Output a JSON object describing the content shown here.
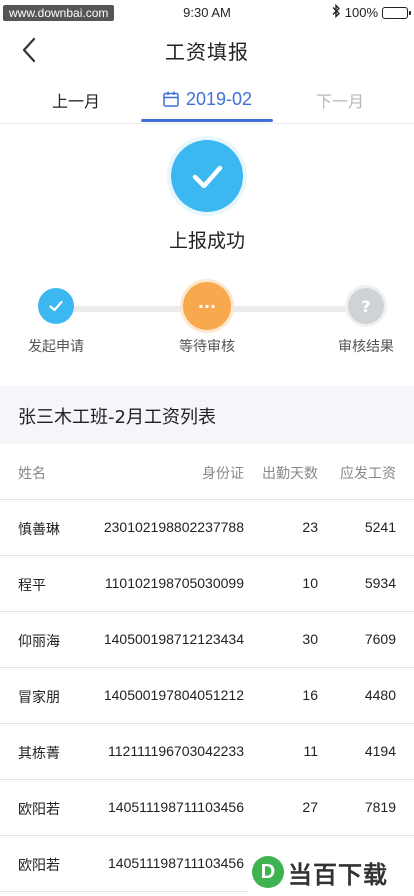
{
  "status_bar": {
    "watermark": "www.downbai.com",
    "time": "9:30 AM",
    "battery": "100%"
  },
  "header": {
    "title": "工资填报"
  },
  "month_tabs": {
    "prev": "上一月",
    "current": "2019-02",
    "next": "下一月"
  },
  "result": {
    "text": "上报成功"
  },
  "steps": [
    {
      "label": "发起申请",
      "state": "done"
    },
    {
      "label": "等待审核",
      "state": "current",
      "symbol": "···"
    },
    {
      "label": "审核结果",
      "state": "pending",
      "symbol": "?"
    }
  ],
  "list": {
    "title": "张三木工班-2月工资列表",
    "columns": [
      "姓名",
      "身份证",
      "出勤天数",
      "应发工资"
    ],
    "rows": [
      {
        "name": "慎善琳",
        "id": "230102198802237788",
        "days": "23",
        "pay": "5241"
      },
      {
        "name": "程平",
        "id": "110102198705030099",
        "days": "10",
        "pay": "5934"
      },
      {
        "name": "仰丽海",
        "id": "140500198712123434",
        "days": "30",
        "pay": "7609"
      },
      {
        "name": "冒家朋",
        "id": "140500197804051212",
        "days": "16",
        "pay": "4480"
      },
      {
        "name": "其栋菁",
        "id": "112111196703042233",
        "days": "11",
        "pay": "4194"
      },
      {
        "name": "欧阳若",
        "id": "140511198711103456",
        "days": "27",
        "pay": "7819"
      },
      {
        "name": "欧阳若",
        "id": "140511198711103456",
        "days": "",
        "pay": ""
      }
    ]
  },
  "corner_logo": {
    "mark": "D",
    "text": "当百下载"
  },
  "colors": {
    "accent": "#3f6fd8",
    "success": "#3ab8ef",
    "waiting": "#f8a94e",
    "pending": "#cfd3d6"
  }
}
